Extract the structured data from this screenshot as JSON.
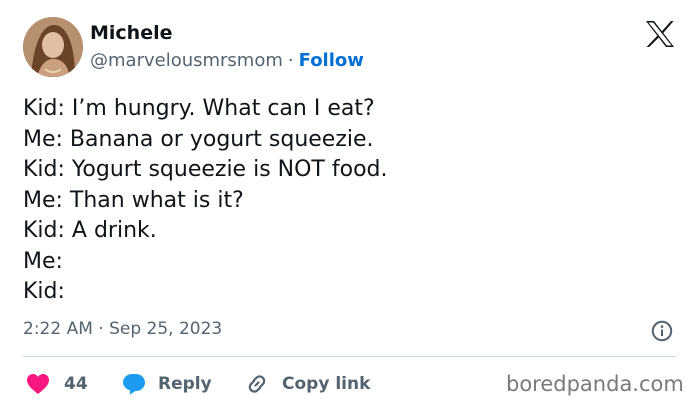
{
  "tweet": {
    "author_name": "Michele",
    "handle": "@marvelousmrsmom",
    "separator": "·",
    "follow_label": "Follow",
    "lines": [
      "Kid: I’m hungry. What can I eat?",
      "Me: Banana or yogurt squeezie.",
      "Kid: Yogurt squeezie is NOT food.",
      "Me: Than what is it?",
      "Kid: A drink.",
      "Me:",
      "Kid:"
    ],
    "timestamp": "2:22 AM · Sep 25, 2023"
  },
  "actions": {
    "likes_count": "44",
    "reply_label": "Reply",
    "copy_link_label": "Copy link"
  },
  "icons": {
    "brand": "x-logo-icon",
    "like": "heart-icon",
    "reply": "speech-bubble-icon",
    "copy": "link-icon",
    "info": "info-icon"
  },
  "colors": {
    "text_primary": "#0f1419",
    "text_secondary": "#536471",
    "follow": "#006fd6",
    "heart": "#f91880",
    "reply_bubble": "#1d9bf0",
    "divider": "#cfd9de"
  },
  "watermark": "boredpanda.com"
}
